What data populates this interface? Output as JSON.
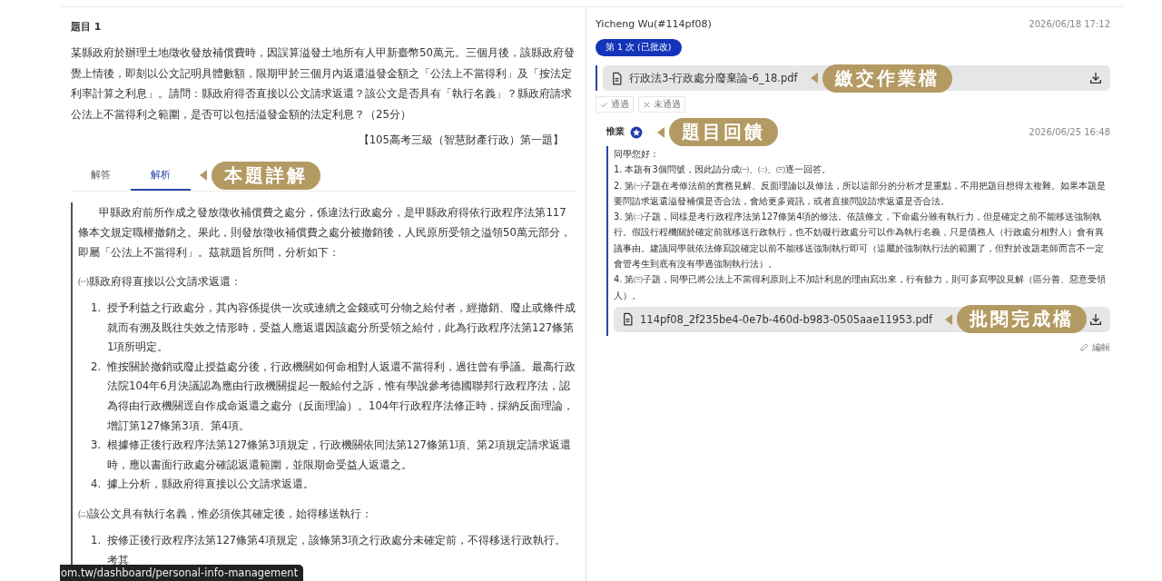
{
  "question": {
    "title": "題目 1",
    "text": "某縣政府於辦理土地徵收發放補償費時，因誤算溢發土地所有人甲新臺幣50萬元。三個月後，該縣政府發覺上情後，即刻以公文記明具體數額，限期甲於三個月內返還溢發金額之「公法上不當得利」及「按法定利率計算之利息」。請問：縣政府得否直接以公文請求返還？該公文是否具有「執行名義」？縣政府請求公法上不當得利之範圍，是否可以包括溢發金額的法定利息？（25分）",
    "source": "【105高考三級（智慧財產行政）第一題】"
  },
  "tabs": [
    {
      "label": "解答",
      "selected": false
    },
    {
      "label": "解析",
      "selected": true
    }
  ],
  "tabs_callout": "本題詳解",
  "analysis": {
    "intro": "甲縣政府前所作成之發放徵收補償費之處分，係違法行政處分，是甲縣政府得依行政程序法第117條本文規定職權撤銷之。果此，則發放徵收補償費之處分被撤銷後，人民原所受領之溢領50萬元部分，即屬「公法上不當得利」。茲就題旨所問，分析如下：",
    "sections": [
      {
        "heading": "㈠縣政府得直接以公文請求返還：",
        "items": [
          {
            "number": "1.",
            "text": "授予利益之行政處分，其內容係提供一次或連續之金錢或可分物之給付者，經撤銷、廢止或條件成就而有溯及既往失效之情形時，受益人應返還因該處分所受領之給付，此為行政程序法第127條第1項所明定。"
          },
          {
            "number": "2.",
            "text": "惟按關於撤銷或廢止授益處分後，行政機關如何命相對人返還不當得利，過往曾有爭議。最高行政法院104年6月決議認為應由行政機關提起一般給付之訴，惟有學說參考德國聯邦行政程序法，認為得由行政機關逕自作成命返還之處分（反面理論）。104年行政程序法修正時，採納反面理論，增訂第127條第3項、第4項。"
          },
          {
            "number": "3.",
            "text": "根據修正後行政程序法第127條第3項規定，行政機關依同法第127條第1項、第2項規定請求返還時，應以書面行政處分確認返還範圍，並限期命受益人返還之。"
          },
          {
            "number": "4.",
            "text": "據上分析，縣政府得直接以公文請求返還。"
          }
        ]
      },
      {
        "heading": "㈡該公文具有執行名義，惟必須俟其確定後，始得移送執行：",
        "items": [
          {
            "number": "1.",
            "text": "按修正後行政程序法第127條第4項規定，該條第3項之行政處分未確定前，不得移送行政執行。考其"
          }
        ]
      }
    ]
  },
  "status_url": "om.tw/dashboard/personal-info-management",
  "submission": {
    "student": "Yicheng Wu(#114pf08)",
    "time": "2026/06/18 17:12",
    "attempt_badge": "第 1 次 (已批改)",
    "file": {
      "name": "行政法3-行政處分廢棄論-6_18.pdf",
      "callout": "繳交作業檔"
    },
    "review_buttons": [
      {
        "label": "通過",
        "kind": "pass"
      },
      {
        "label": "未通過",
        "kind": "fail"
      }
    ]
  },
  "feedback": {
    "author": "惟業",
    "callout": "題目回饋",
    "time": "2026/06/25 16:48",
    "lines": [
      "同學您好：",
      "1. 本題有3個問號，因此請分成㈠、㈡、㈢逐一回答。",
      "2. 第㈠子題在考修法前的實務見解、反面理論以及修法，所以這部分的分析才是重點，不用把題目想得太複雜。如果本題是要問請求返還溢發補償是否合法，會給更多資訊，或者直接問說請求返還是否合法。",
      "3. 第㈡子題，同樣是考行政程序法第127條第4項的修法。依該條文，下命處分雖有執行力，但是確定之前不能移送強制執行。假設行程機關於確定前就移送行政執行，也不妨礙行政處分可以作為執行名義，只是債務人（行政處分相對人）會有異議事由。建議同學就依法條寫說確定以前不能移送強制執行即可（這屬於強制執行法的範圍了，但對於改題老師而言不一定會管考生到底有沒有學過強制執行法）。",
      "4. 第㈢子題，同學已將公法上不當得利原則上不加計利息的理由寫出來，行有餘力，則可多寫學說見解（區分善、惡意受領人）。"
    ],
    "file": {
      "name": "114pf08_2f235be4-0e7b-460d-b983-0505aae11953.pdf",
      "callout": "批閱完成檔"
    },
    "edit_label": "編輯"
  }
}
